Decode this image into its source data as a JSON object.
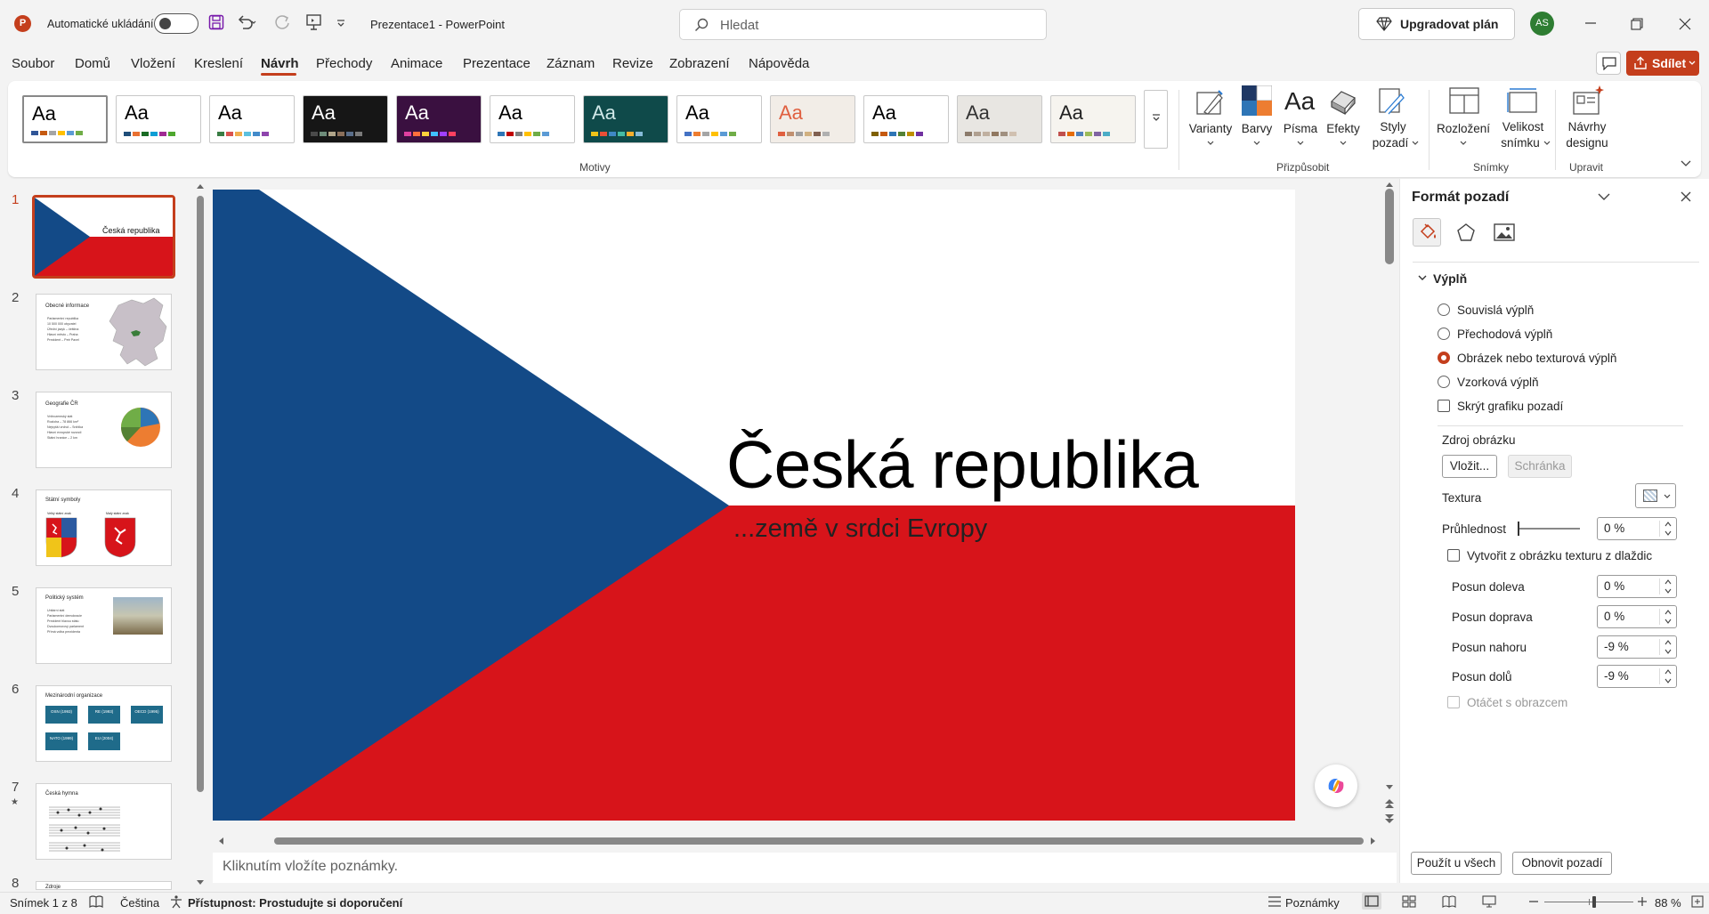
{
  "app": {
    "autosave_label": "Automatické ukládání",
    "doc_title": "Prezentace1  -  PowerPoint",
    "search_placeholder": "Hledat",
    "upgrade_label": "Upgradovat plán",
    "avatar_initials": "AS",
    "share_label": "Sdílet",
    "accent_color": "#c43e1c"
  },
  "tabs": [
    "Soubor",
    "Domů",
    "Vložení",
    "Kreslení",
    "Návrh",
    "Přechody",
    "Animace",
    "Prezentace",
    "Záznam",
    "Revize",
    "Zobrazení",
    "Nápověda"
  ],
  "active_tab": "Návrh",
  "ribbon": {
    "themes_group_label": "Motivy",
    "themes": [
      {
        "aa": "Aa",
        "bg": "#ffffff",
        "fg": "#000000",
        "colors": [
          "#2f5597",
          "#c55a11",
          "#a5a5a5",
          "#ffc000",
          "#5b9bd5",
          "#70ad47"
        ]
      },
      {
        "aa": "Aa",
        "bg": "#ffffff",
        "fg": "#000000",
        "colors": [
          "#1f4e79",
          "#e97132",
          "#196b24",
          "#0f9ed5",
          "#a02b93",
          "#4ea72e"
        ]
      },
      {
        "aa": "Aa",
        "bg": "#ffffff",
        "fg": "#000000",
        "colors": [
          "#3a7d44",
          "#d9534f",
          "#f0ad4e",
          "#5bc0de",
          "#428bca",
          "#8e44ad"
        ]
      },
      {
        "aa": "Aa",
        "bg": "#161616",
        "fg": "#ffffff",
        "colors": [
          "#4a4a4a",
          "#6e8c7a",
          "#b0a58a",
          "#8a6f5a",
          "#5a6e8a",
          "#7a7a7a"
        ]
      },
      {
        "aa": "Aa",
        "bg": "#3a1040",
        "fg": "#ffffff",
        "colors": [
          "#e040a0",
          "#ff6f3c",
          "#ffd23c",
          "#40c0ff",
          "#a040ff",
          "#ff4060"
        ]
      },
      {
        "aa": "Aa",
        "bg": "#ffffff",
        "fg": "#000000",
        "colors": [
          "#2e75b6",
          "#c00000",
          "#7f7f7f",
          "#ffc000",
          "#70ad47",
          "#5b9bd5"
        ]
      },
      {
        "aa": "Aa",
        "bg": "#0f4a4a",
        "fg": "#cfe8e8",
        "colors": [
          "#f0c419",
          "#e94f37",
          "#3f88c5",
          "#44bba4",
          "#f6ae2d",
          "#86bbd8"
        ]
      },
      {
        "aa": "Aa",
        "bg": "#ffffff",
        "fg": "#000000",
        "colors": [
          "#4472c4",
          "#ed7d31",
          "#a5a5a5",
          "#ffc000",
          "#5b9bd5",
          "#70ad47"
        ]
      },
      {
        "aa": "Aa",
        "bg": "#f2ede7",
        "fg": "#e06040",
        "colors": [
          "#e06040",
          "#c09070",
          "#a0a0a0",
          "#d0b080",
          "#806050",
          "#b0b0b0"
        ]
      },
      {
        "aa": "Aa",
        "bg": "#ffffff",
        "fg": "#000000",
        "colors": [
          "#7f6000",
          "#c55a11",
          "#2e75b6",
          "#548235",
          "#bf9000",
          "#7030a0"
        ]
      },
      {
        "aa": "Aa",
        "bg": "#e8e6e2",
        "fg": "#333333",
        "colors": [
          "#8c7b6b",
          "#b0a090",
          "#c0b0a0",
          "#907860",
          "#a09080",
          "#d0c0b0"
        ]
      },
      {
        "aa": "Aa",
        "bg": "#f6f4ef",
        "fg": "#222222",
        "colors": [
          "#c0504d",
          "#e46c0a",
          "#4f81bd",
          "#9bbb59",
          "#8064a2",
          "#4bacc6"
        ]
      }
    ],
    "customize_group_label": "Přizpůsobit",
    "variants": "Varianty",
    "colors": "Barvy",
    "fonts": "Písma",
    "fonts_aa": "Aa",
    "effects": "Efekty",
    "bg_styles_1": "Styly",
    "bg_styles_2": "pozadí",
    "slides_group_label": "Snímky",
    "layout_1": "Rozložení",
    "slide_size_1": "Velikost",
    "slide_size_2": "snímku",
    "designer_group_label": "Upravit",
    "designer_1": "Návrhy",
    "designer_2": "designu"
  },
  "slides": [
    {
      "num": "1",
      "title": "Česká republika"
    },
    {
      "num": "2",
      "title": "Obecné informace",
      "bullets": [
        "Parlamentní republika",
        "10 500 000 obyvatel",
        "Úřední jazyk – čeština",
        "Hlavní město – Praha",
        "Prezident – Petr Pavel"
      ]
    },
    {
      "num": "3",
      "title": "Geografie ČR",
      "bullets": [
        "Vnitrozemský stát",
        "Rozloha – 78 866 km²",
        "Nejvyšší vrchol – Sněžka",
        "Hlavní evropské rozvodí",
        "Státní hranice – 2 km"
      ]
    },
    {
      "num": "4",
      "title": "Státní symboly",
      "cap1": "Velký státní znak",
      "cap2": "Malý státní znak"
    },
    {
      "num": "5",
      "title": "Politický systém",
      "bullets": [
        "Unitární stát",
        "Parlamentní demokracie",
        "Prezident hlavou státu",
        "Dvoukomorový parlament",
        "Přímá volba prezidenta"
      ]
    },
    {
      "num": "6",
      "title": "Mezinárodní organizace",
      "boxes": [
        "OSN (1993)",
        "RE (1993)",
        "OECD (1995)",
        "NATO (1999)",
        "EU (2004)"
      ]
    },
    {
      "num": "7",
      "title": "Česká hymna"
    },
    {
      "num": "8",
      "title": "Zdroje"
    }
  ],
  "main_slide": {
    "title": "Česká republika",
    "subtitle": "...země v srdci Evropy",
    "flag_blue": "#134a87",
    "flag_red": "#d7141a",
    "flag_white": "#ffffff"
  },
  "notes_placeholder": "Kliknutím vložíte poznámky.",
  "pane": {
    "title": "Formát pozadí",
    "section": "Výplň",
    "options": [
      "Souvislá výplň",
      "Přechodová výplň",
      "Obrázek nebo texturová výplň",
      "Vzorková výplň"
    ],
    "selected_option": 2,
    "hide_graphics": "Skrýt grafiku pozadí",
    "image_source": "Zdroj obrázku",
    "insert_btn": "Vložit...",
    "clipboard_btn": "Schránka",
    "texture": "Textura",
    "transparency": "Průhlednost",
    "transparency_val": "0 %",
    "tile": "Vytvořit z obrázku texturu z dlaždic",
    "offset_left": "Posun doleva",
    "offset_left_val": "0 %",
    "offset_right": "Posun doprava",
    "offset_right_val": "0 %",
    "offset_top": "Posun nahoru",
    "offset_top_val": "-9 %",
    "offset_bottom": "Posun dolů",
    "offset_bottom_val": "-9 %",
    "rotate": "Otáčet s obrazcem",
    "apply_all": "Použít u všech",
    "reset_bg": "Obnovit pozadí"
  },
  "status": {
    "slide_of": "Snímek 1 z 8",
    "language": "Čeština",
    "accessibility": "Přístupnost: Prostudujte si doporučení",
    "notes": "Poznámky",
    "zoom": "88 %"
  }
}
